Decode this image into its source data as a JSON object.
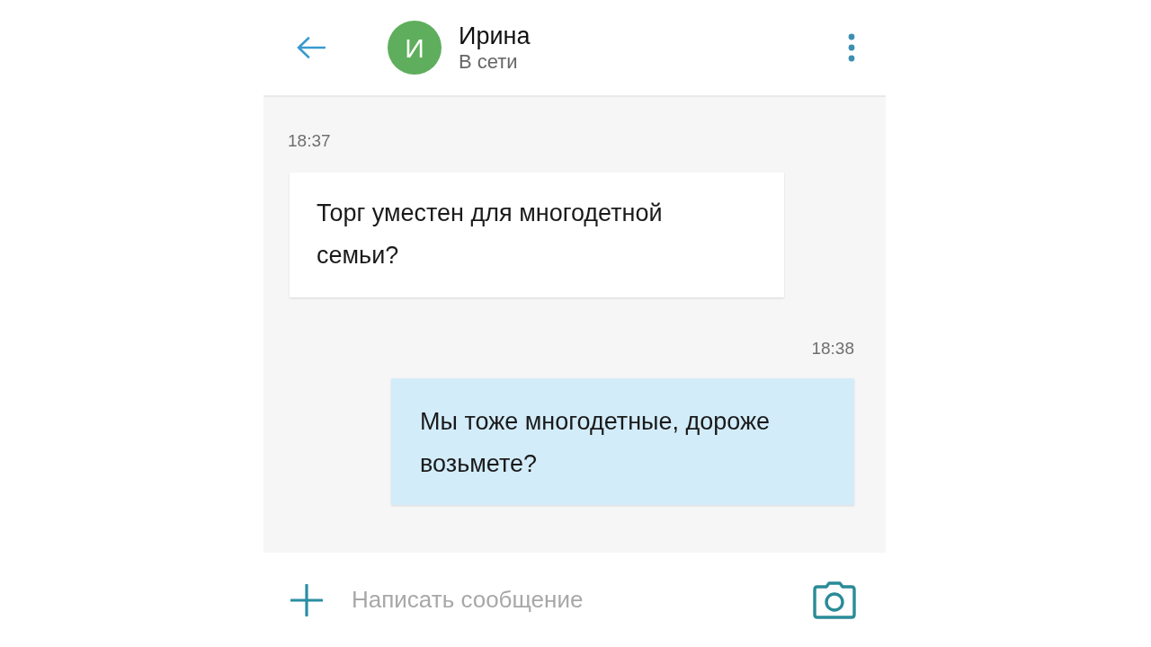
{
  "header": {
    "initial": "И",
    "name": "Ирина",
    "status": "В сети"
  },
  "messages": [
    {
      "kind": "incoming",
      "time": "18:37",
      "text": "Торг уместен для многодетной семьи?"
    },
    {
      "kind": "outgoing",
      "time": "18:38",
      "text": "Мы тоже многодетные, дороже возьмете?"
    }
  ],
  "composer": {
    "placeholder": "Написать сообщение"
  }
}
